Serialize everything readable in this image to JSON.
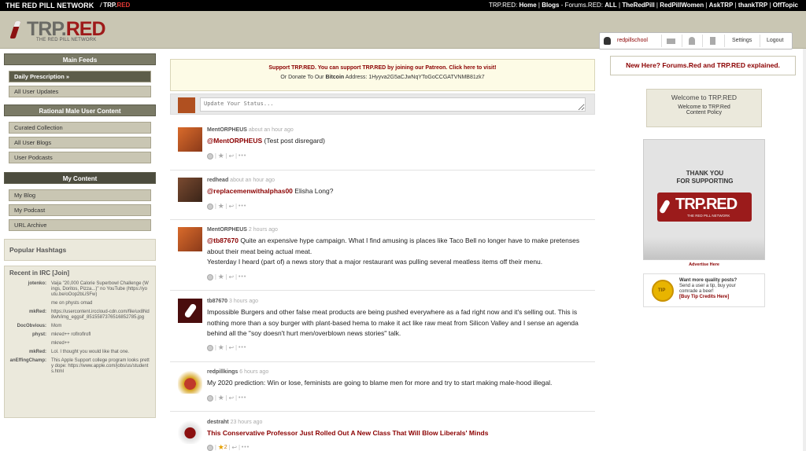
{
  "topbar": {
    "network": "THE RED PILL NETWORK",
    "trp_prefix": "TRP.",
    "trp_suffix": "RED",
    "links_prefix": "TRP.RED: ",
    "home": "Home",
    "blogs": "Blogs",
    "forums_prefix": " - Forums.RED: ",
    "all": "ALL",
    "theredpill": "TheRedPill",
    "redpillwomen": "RedPillWomen",
    "asktrp": "AskTRP",
    "thanktrp": "thankTRP",
    "offtopic": "OffTopic",
    "sep": " | "
  },
  "header": {
    "logo_trp": "TRP.",
    "logo_red": "RED",
    "logo_sub": "THE RED PILL NETWORK"
  },
  "userbox": {
    "username": "redpillschool",
    "settings": "Settings",
    "logout": "Logout"
  },
  "sidebar": {
    "main_feeds": "Main Feeds",
    "daily": "Daily Prescription »",
    "all_updates": "All User Updates",
    "rational": "Rational Male User Content",
    "curated": "Curated Collection",
    "all_blogs": "All User Blogs",
    "podcasts": "User Podcasts",
    "my_content": "My Content",
    "my_blog": "My Blog",
    "my_podcast": "My Podcast",
    "url_archive": "URL Archive",
    "popular": "Popular Hashtags",
    "irc_title": "Recent in IRC [Join]",
    "irc": [
      {
        "n": "jotenko:",
        "m": "Vaija \"20,000 Calorie Superbowl Challenge (Wings, Doritos, Pizza...)\" no YouTube (https://youtu.be/oOop2bLiSFw)"
      },
      {
        "n": "",
        "m": "me on physts omad"
      },
      {
        "n": "mkRed:",
        "m": "https://usercontent.irccloud-cdn.com/file/ux8Nd8wh/img_eggsif_8515587376516852785.jpg"
      },
      {
        "n": "DocObvious:",
        "m": "Mom"
      },
      {
        "n": "physt:",
        "m": "mkred++ roflroflrofl"
      },
      {
        "n": "",
        "m": "mkred++"
      },
      {
        "n": "mkRed:",
        "m": "Lol. I thought you would like that one."
      },
      {
        "n": "anEffingChamp:",
        "m": "This Apple Support college program looks pretty dope: https://www.apple.com/jobs/us/students.html"
      }
    ]
  },
  "support": {
    "line1": "Support TRP.RED. You can support TRP.RED by joining our Patreon. Click here to visit!",
    "line2_pre": "Or Donate To Our ",
    "line2_b": "Bitcoin",
    "line2_post": " Address: 1Hyyva2G5aCJwNqYToGoCCGATVNMB81zk7"
  },
  "status": {
    "placeholder": "Update Your Status..."
  },
  "posts": [
    {
      "user": "MentORPHEUS",
      "time": " about an hour ago",
      "mention": "@MentORPHEUS",
      "text": " (Test post disregard)"
    },
    {
      "user": "redhead",
      "time": " about an hour ago",
      "mention": "@replacemenwithalphas00",
      "text": " Elisha Long?"
    },
    {
      "user": "MentORPHEUS",
      "time": " 2 hours ago",
      "mention": "@tb87670",
      "text": " Quite an expensive hype campaign. What I find amusing is places like Taco Bell no longer have to make pretenses about their meat being actual meat.",
      "text2": "Yesterday I heard (part of) a news story that a major restaurant was pulling several meatless items off their menu."
    },
    {
      "user": "tb87670",
      "time": " 3 hours ago",
      "text": "Impossible Burgers and other false meat products are being pushed everywhere as a fad right now and it's selling out. This is nothing more than a soy burger with plant-based hema to make it act like raw meat from Silicon Valley and I sense an agenda behind all the \"soy doesn't hurt men/overblown news stories\" talk."
    },
    {
      "user": "redpillkings",
      "time": " 6 hours ago",
      "text": "My 2020 prediction: Win or lose, feminists are going to blame men for more and try to start making male-hood illegal."
    },
    {
      "user": "destraht",
      "time": " 23 hours ago",
      "title": "This Conservative Professor Just Rolled Out A New Class That Will Blow Liberals' Minds",
      "count": "2"
    }
  ],
  "right": {
    "new_here": "New Here? Forums.Red and TRP.RED explained.",
    "welcome_title": "Welcome to TRP.RED",
    "welcome_line1": "Welcome to TRP.Red",
    "welcome_line2": "Content Policy",
    "thank": "THANK YOU",
    "for_supporting": "FOR SUPPORTING",
    "ad_trp": "TRP.RED",
    "ad_sub": "THE RED PILL NETWORK",
    "advertise": "Advertise Here",
    "tip_coin": "TIP",
    "tip1": "Want more quality posts?",
    "tip2": "Send a user a tip, buy your",
    "tip3": "comrade a beer!",
    "tip4": "[Buy Tip Credits Here]"
  },
  "colors": {
    "brand_red": "#8b0000",
    "header_bg": "#c9c6b3",
    "section_bg": "#7a7a66"
  }
}
